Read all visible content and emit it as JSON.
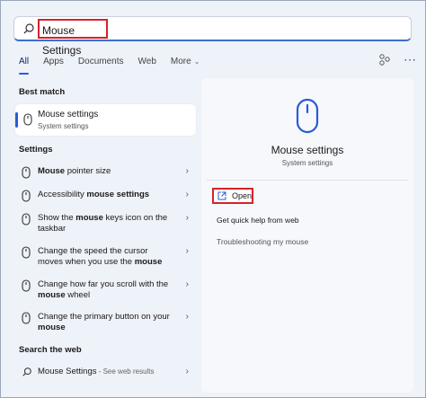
{
  "search": {
    "value": "Mouse Settings"
  },
  "tabs": [
    {
      "label": "All"
    },
    {
      "label": "Apps"
    },
    {
      "label": "Documents"
    },
    {
      "label": "Web"
    },
    {
      "label": "More"
    }
  ],
  "best_match": {
    "heading": "Best match",
    "title": "Mouse settings",
    "subtitle": "System settings"
  },
  "settings": {
    "heading": "Settings",
    "items": [
      {
        "pre": "",
        "bold": "Mouse",
        "post": " pointer size"
      },
      {
        "pre": "Accessibility ",
        "bold": "mouse settings",
        "post": ""
      },
      {
        "pre": "Show the ",
        "bold": "mouse",
        "post": " keys icon on the taskbar"
      },
      {
        "pre": "Change the speed the cursor moves when you use the ",
        "bold": "mouse",
        "post": ""
      },
      {
        "pre": "Change how far you scroll with the ",
        "bold": "mouse",
        "post": " wheel"
      },
      {
        "pre": "Change the primary button on your ",
        "bold": "mouse",
        "post": ""
      }
    ]
  },
  "web": {
    "heading": "Search the web",
    "item_title": "Mouse Settings",
    "item_suffix": " - See web results"
  },
  "panel": {
    "title": "Mouse settings",
    "subtitle": "System settings",
    "open_label": "Open",
    "actions": [
      "Get quick help from web",
      "Troubleshooting my mouse"
    ]
  },
  "colors": {
    "accent": "#2a5bd7",
    "highlight_box": "#d6222b"
  },
  "icons": [
    "search-icon",
    "mouse-icon",
    "chevron-right-icon",
    "chevron-down-icon",
    "open-external-icon",
    "network-icon",
    "more-options-icon"
  ]
}
